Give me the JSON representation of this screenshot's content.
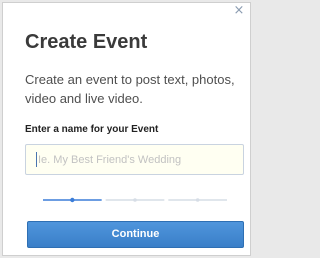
{
  "dialog": {
    "close_label": "×",
    "title": "Create Event",
    "description": "Create an event to post text, photos, video and live video.",
    "name_label": "Enter a name for your Event",
    "name_value": "",
    "name_placeholder": "Ie. My Best Friend's Wedding",
    "steps": {
      "total": 3,
      "current": 1,
      "active_color": "#3b7dd8",
      "inactive_color": "#d6dde6"
    },
    "continue_label": "Continue"
  }
}
